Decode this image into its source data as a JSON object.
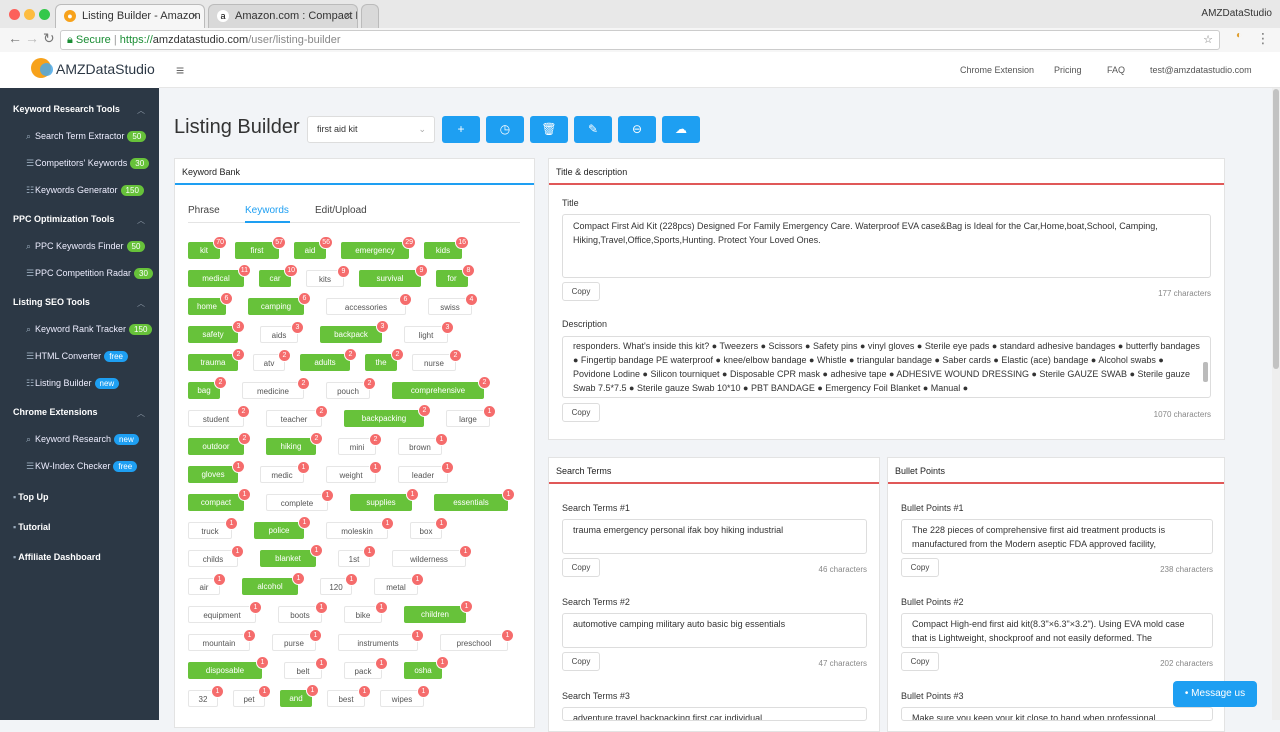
{
  "browser": {
    "user": "AMZDataStudio",
    "tabs": [
      {
        "title": "Listing Builder - Amazon Produ"
      },
      {
        "title": "Amazon.com : Compact First A"
      }
    ],
    "secure": "Secure",
    "url_scheme": "https://",
    "url_host": "amzdatastudio.com",
    "url_path": "/user/listing-builder"
  },
  "brand": {
    "name": "AMZDataStudio"
  },
  "sidebar": {
    "sections": [
      {
        "label": "Keyword Research Tools",
        "items": [
          {
            "label": "Search Term Extractor",
            "badge": "50"
          },
          {
            "label": "Competitors' Keywords",
            "badge": "30"
          },
          {
            "label": "Keywords Generator",
            "badge": "150"
          }
        ]
      },
      {
        "label": "PPC Optimization Tools",
        "items": [
          {
            "label": "PPC Keywords Finder",
            "badge": "50"
          },
          {
            "label": "PPC Competition Radar",
            "badge": "30"
          }
        ]
      },
      {
        "label": "Listing SEO Tools",
        "items": [
          {
            "label": "Keyword Rank Tracker",
            "badge": "150"
          },
          {
            "label": "HTML Converter",
            "badge": "free"
          },
          {
            "label": "Listing Builder",
            "badge": "new"
          }
        ]
      },
      {
        "label": "Chrome Extensions",
        "items": [
          {
            "label": "Keyword Research",
            "badge": "new"
          },
          {
            "label": "KW-Index Checker",
            "badge": "free"
          }
        ]
      }
    ],
    "bottom": [
      "Top Up",
      "Tutorial",
      "Affiliate Dashboard"
    ]
  },
  "topnav": {
    "links": [
      "Chrome Extension",
      "Pricing",
      "FAQ"
    ],
    "email": "test@amzdatastudio.com"
  },
  "page": {
    "title": "Listing Builder",
    "select_value": "first aid kit"
  },
  "keyword_bank": {
    "title": "Keyword Bank",
    "tabs": [
      "Phrase",
      "Keywords",
      "Edit/Upload"
    ],
    "active_tab": "Keywords",
    "rows": [
      [
        [
          "kit",
          70,
          1
        ],
        [
          "first",
          57,
          1
        ],
        [
          "aid",
          56,
          1
        ],
        [
          "emergency",
          29,
          1
        ],
        [
          "kids",
          16,
          1
        ]
      ],
      [
        [
          "medical",
          11,
          1
        ],
        [
          "car",
          10,
          1
        ],
        [
          "kits",
          9,
          0
        ],
        [
          "survival",
          9,
          1
        ],
        [
          "for",
          8,
          1
        ]
      ],
      [
        [
          "home",
          6,
          1
        ],
        [
          "camping",
          6,
          1
        ],
        [
          "accessories",
          6,
          0
        ],
        [
          "swiss",
          4,
          0
        ]
      ],
      [
        [
          "safety",
          3,
          1
        ],
        [
          "aids",
          3,
          0
        ],
        [
          "backpack",
          3,
          1
        ],
        [
          "light",
          3,
          0
        ]
      ],
      [
        [
          "trauma",
          2,
          1
        ],
        [
          "atv",
          2,
          0
        ],
        [
          "adults",
          2,
          1
        ],
        [
          "the",
          2,
          1
        ],
        [
          "nurse",
          2,
          0
        ]
      ],
      [
        [
          "bag",
          2,
          1
        ],
        [
          "medicine",
          2,
          0
        ],
        [
          "pouch",
          2,
          0
        ],
        [
          "comprehensive",
          2,
          1
        ]
      ],
      [
        [
          "student",
          2,
          0
        ],
        [
          "teacher",
          2,
          0
        ],
        [
          "backpacking",
          2,
          1
        ],
        [
          "large",
          1,
          0
        ]
      ],
      [
        [
          "outdoor",
          2,
          1
        ],
        [
          "hiking",
          2,
          1
        ],
        [
          "mini",
          2,
          0
        ],
        [
          "brown",
          1,
          0
        ]
      ],
      [
        [
          "gloves",
          1,
          1
        ],
        [
          "medic",
          1,
          0
        ],
        [
          "weight",
          1,
          0
        ],
        [
          "leader",
          1,
          0
        ]
      ],
      [
        [
          "compact",
          1,
          1
        ],
        [
          "complete",
          1,
          0
        ],
        [
          "supplies",
          1,
          1
        ],
        [
          "essentials",
          1,
          1
        ]
      ],
      [
        [
          "truck",
          1,
          0
        ],
        [
          "police",
          1,
          1
        ],
        [
          "moleskin",
          1,
          0
        ],
        [
          "box",
          1,
          0
        ]
      ],
      [
        [
          "childs",
          1,
          0
        ],
        [
          "blanket",
          1,
          1
        ],
        [
          "1st",
          1,
          0
        ],
        [
          "wilderness",
          1,
          0
        ]
      ],
      [
        [
          "air",
          1,
          0
        ],
        [
          "alcohol",
          1,
          1
        ],
        [
          "120",
          1,
          0
        ],
        [
          "metal",
          1,
          0
        ]
      ],
      [
        [
          "equipment",
          1,
          0
        ],
        [
          "boots",
          1,
          0
        ],
        [
          "bike",
          1,
          0
        ],
        [
          "children",
          1,
          1
        ]
      ],
      [
        [
          "mountain",
          1,
          0
        ],
        [
          "purse",
          1,
          0
        ],
        [
          "instruments",
          1,
          0
        ],
        [
          "preschool",
          1,
          0
        ]
      ],
      [
        [
          "disposable",
          1,
          1
        ],
        [
          "belt",
          1,
          0
        ],
        [
          "pack",
          1,
          0
        ],
        [
          "osha",
          1,
          1
        ]
      ],
      [
        [
          "32",
          1,
          0
        ],
        [
          "pet",
          1,
          0
        ],
        [
          "and",
          1,
          1
        ],
        [
          "best",
          1,
          0
        ],
        [
          "wipes",
          1,
          0
        ]
      ]
    ]
  },
  "title_desc": {
    "panel": "Title & description",
    "title_label": "Title",
    "title_text": "Compact First Aid Kit (228pcs) Designed For Family Emergency Care. Waterproof EVA case&Bag is Ideal for the Car,Home,boat,School, Camping, Hiking,Travel,Office,Sports,Hunting. Protect Your Loved Ones.",
    "title_chars": "177 characters",
    "desc_label": "Description",
    "desc_text": "responders.    What's inside this kit?    ● Tweezers ● Scissors ● Safety pins ● vinyl gloves ● Sterile eye pads ● standard adhesive bandages ● butterfly bandages ● Fingertip bandage PE waterproof ● knee/elbow bandage ● Whistle ● triangular bandage ● Saber cards ● Elastic (ace) bandage ● Alcohol swabs ● Povidone Lodine ● Silicon tourniquet ● Disposable CPR mask ● adhesive tape ● ADHESIVE WOUND DRESSING ● Sterile GAUZE SWAB ● Sterile gauze Swab 7.5*7.5 ● Sterile gauze Swab 10*10 ● PBT BANDAGE ● Emergency Foil Blanket ● Manual ●",
    "desc_chars": "1070 characters",
    "copy": "Copy"
  },
  "search_terms": {
    "panel": "Search Terms",
    "items": [
      {
        "label": "Search Terms #1",
        "text": "trauma emergency personal ifak boy hiking industrial",
        "chars": "46 characters"
      },
      {
        "label": "Search Terms #2",
        "text": "automotive camping military auto basic big essentials",
        "chars": "47 characters"
      },
      {
        "label": "Search Terms #3",
        "text": "adventure travel backpacking first car individual",
        "chars": ""
      }
    ]
  },
  "bullet_points": {
    "panel": "Bullet Points",
    "items": [
      {
        "label": "Bullet Points #1",
        "text": "The 228 pieces of comprehensive first aid treatment products is manufactured from the Modern aseptic FDA approved facility,",
        "chars": "238 characters"
      },
      {
        "label": "Bullet Points #2",
        "text": "Compact High-end first aid kit(8.3\"×6.3\"×3.2\"). Using EVA mold case that is Lightweight, shockproof and not easily deformed. The",
        "chars": "202 characters"
      },
      {
        "label": "Bullet Points #3",
        "text": "Make sure you keep your kit close to hand when professional",
        "chars": ""
      }
    ]
  },
  "chat": {
    "label": "Message us"
  },
  "colors": {
    "sidebar": "#2c3845",
    "accent": "#1e9ff2",
    "green": "#67c23a",
    "red": "#f56c6c"
  }
}
